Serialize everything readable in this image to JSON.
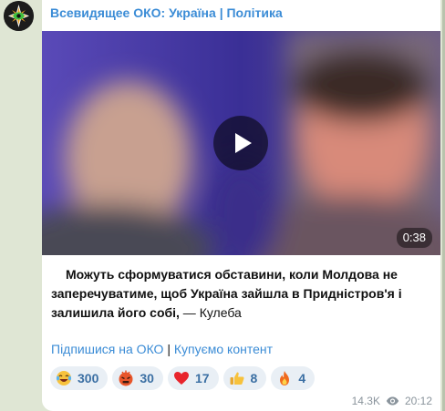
{
  "channel": {
    "title": "Всевидящее ОКО: Україна | Політика",
    "avatar_icon": "eye-logo-icon"
  },
  "media": {
    "type": "video",
    "blurred": true,
    "duration": "0:38",
    "play_icon": "play-icon"
  },
  "message": {
    "quote_text": "Можуть сформуватися обставини, коли Молдова не заперечуватиме, щоб Україна зайшла в Придністров'я і залишила його собі,",
    "attribution": " — Кулеба"
  },
  "links": {
    "subscribe": "Підпишися на ОКО",
    "separator": " | ",
    "buy_content": "Купуємо контент"
  },
  "reactions": [
    {
      "icon": "laughing-crying-face-icon",
      "count": "300"
    },
    {
      "icon": "angry-face-icon",
      "count": "30"
    },
    {
      "icon": "red-heart-icon",
      "count": "17"
    },
    {
      "icon": "thumbs-up-icon",
      "count": "8"
    },
    {
      "icon": "fire-icon",
      "count": "4"
    }
  ],
  "meta": {
    "views": "14.3K",
    "views_icon": "eye-icon",
    "time": "20:12"
  },
  "colors": {
    "accent": "#3b8cd6",
    "background": "#dfe6d4",
    "bubble": "#ffffff",
    "reaction_bg": "#e9eff5"
  }
}
